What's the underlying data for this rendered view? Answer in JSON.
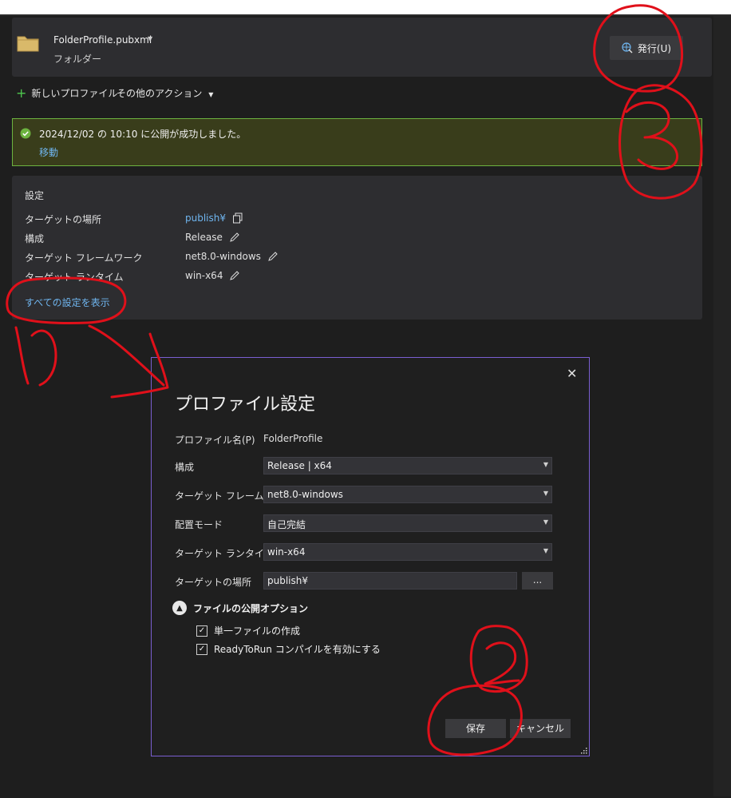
{
  "header": {
    "profile_name": "FolderProfile.pubxml",
    "profile_type": "フォルダー",
    "publish_button": "発行(U)"
  },
  "toolbar": {
    "new_profile": "新しいプロファイル",
    "other_actions": "その他のアクション"
  },
  "banner": {
    "message": "2024/12/02 の 10:10 に公開が成功しました。",
    "link": "移動",
    "color": "#6cb33f"
  },
  "settings": {
    "title": "設定",
    "rows": [
      {
        "label": "ターゲットの場所",
        "value": "publish¥",
        "icon": "copy-icon"
      },
      {
        "label": "構成",
        "value": "Release",
        "icon": "edit-icon"
      },
      {
        "label": "ターゲット フレームワーク",
        "value": "net8.0-windows",
        "icon": "edit-icon"
      },
      {
        "label": "ターゲット ランタイム",
        "value": "win-x64",
        "icon": "edit-icon"
      }
    ],
    "show_all": "すべての設定を表示"
  },
  "dialog": {
    "title": "プロファイル設定",
    "profile_name_label": "プロファイル名(P)",
    "profile_name_value": "FolderProfile",
    "fields": [
      {
        "label": "構成",
        "value": "Release | x64"
      },
      {
        "label": "ターゲット フレームワーク",
        "value": "net8.0-windows"
      },
      {
        "label": "配置モード",
        "value": "自己完結"
      },
      {
        "label": "ターゲット ランタイム",
        "value": "win-x64"
      }
    ],
    "target_location_label": "ターゲットの場所",
    "target_location_value": "publish¥",
    "browse": "...",
    "options_header": "ファイルの公開オプション",
    "options": [
      {
        "label": "単一ファイルの作成",
        "checked": true
      },
      {
        "label": "ReadyToRun コンパイルを有効にする",
        "checked": true
      }
    ],
    "save": "保存",
    "cancel": "キャンセル",
    "accent": "#7a5fd1"
  },
  "annotations": {
    "color": "#e0101a",
    "numbers": [
      "1",
      "2",
      "3"
    ]
  }
}
